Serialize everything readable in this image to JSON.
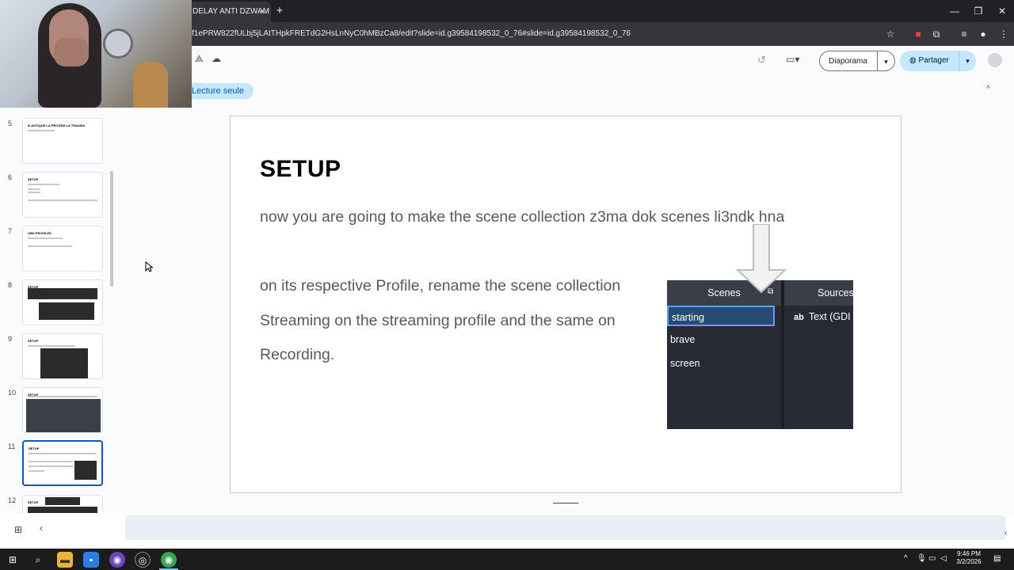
{
  "browser": {
    "tab_title": "DELAY ANTI DZWAM",
    "tab_close": "✕",
    "new_tab": "+",
    "url": "f1ePRW822fULbj5jLAtTHpkFRETdG2HsLnNyC0hMBzCa8/edit?slide=id.g39584198532_0_76#slide=id.g39584198532_0_76",
    "window_controls": [
      "—",
      "❐",
      "✕"
    ]
  },
  "slides_app": {
    "read_only_label": "Lecture seule",
    "slideshow_button": "Diaporama",
    "share_button": "Partager",
    "dropdown_caret": "▾",
    "collapse_caret": "^"
  },
  "filmstrip": {
    "slides": [
      {
        "number": "5",
        "title": "ill ANTIQUE LA PROGEM LA TRAUMA"
      },
      {
        "number": "6",
        "title": "SETUP"
      },
      {
        "number": "7",
        "title": "OBS PROFILES"
      },
      {
        "number": "8",
        "title": "SETUP"
      },
      {
        "number": "9",
        "title": "SETUP"
      },
      {
        "number": "10",
        "title": "SETUP"
      },
      {
        "number": "11",
        "title": "SETUP"
      },
      {
        "number": "12",
        "title": "SETUP"
      }
    ],
    "grid_icon": "⊞",
    "collapse_icon": "‹"
  },
  "slide": {
    "title": "SETUP",
    "line1": "now you are going to make the scene collection z3ma dok scenes li3ndk hna",
    "line2": "on its respective Profile, rename the scene collection",
    "line3": "Streaming on the streaming profile and the same on",
    "line4": "Recording."
  },
  "obs_panel": {
    "scenes_header": "Scenes",
    "sources_header": "Sources",
    "scenes": [
      "starting",
      "brave",
      "screen"
    ],
    "active_scene": "starting",
    "source_icon": "ab",
    "source_item": "Text (GDI"
  },
  "taskbar": {
    "time": "9:46 PM",
    "date": "3/2/2026"
  },
  "colors": {
    "accent": "#0b57d0",
    "share_bg": "#c2e7ff",
    "obs_active": "#284b74"
  }
}
